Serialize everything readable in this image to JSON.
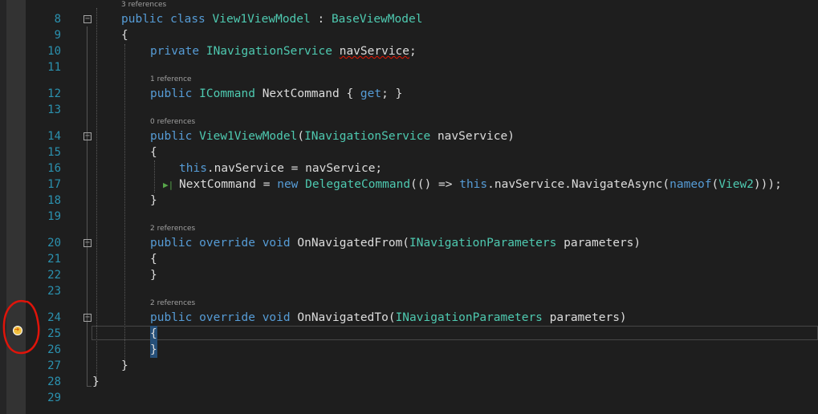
{
  "editor": {
    "codelens": {
      "line8": "3 references",
      "line12": "1 reference",
      "line14": "0 references",
      "line20": "2 references",
      "line24": "2 references"
    },
    "line_numbers": [
      "8",
      "9",
      "10",
      "11",
      "12",
      "13",
      "14",
      "15",
      "16",
      "17",
      "18",
      "19",
      "20",
      "21",
      "22",
      "23",
      "24",
      "25",
      "26",
      "27",
      "28",
      "29"
    ],
    "lines": {
      "l8": {
        "kw1": "public",
        "kw2": "class",
        "name": "View1ViewModel",
        "sep": " : ",
        "base": "BaseViewModel"
      },
      "l9": {
        "text": "{"
      },
      "l10": {
        "kw": "private",
        "type": "INavigationService",
        "field": "navService",
        "semi": ";"
      },
      "l12": {
        "kw": "public",
        "type": "ICommand",
        "rest": "NextCommand { ",
        "get": "get",
        "end": "; }"
      },
      "l14": {
        "kw": "public",
        "ctor": "View1ViewModel",
        "open": "(",
        "type": "INavigationService",
        "param": " navService)"
      },
      "l15": {
        "text": "{"
      },
      "l16": {
        "kw": "this",
        "rest": ".navService = navService;"
      },
      "l17": {
        "a": "NextCommand = ",
        "kw_new": "new",
        "type": "DelegateCommand",
        "b": "(() => ",
        "kw_this": "this",
        "c": ".navService.NavigateAsync(",
        "kw_nameof": "nameof",
        "d": "(",
        "type2": "View2",
        "e": ")));"
      },
      "l18": {
        "text": "}"
      },
      "l20": {
        "kw1": "public",
        "kw2": "override",
        "kw3": "void",
        "method": "OnNavigatedFrom(",
        "type": "INavigationParameters",
        "param": " parameters)"
      },
      "l21": {
        "text": "{"
      },
      "l22": {
        "text": "}"
      },
      "l24": {
        "kw1": "public",
        "kw2": "override",
        "kw3": "void",
        "method": "OnNavigatedTo(",
        "type": "INavigationParameters",
        "param": " parameters)"
      },
      "l25": {
        "text": "{"
      },
      "l26": {
        "text": "}"
      },
      "l27": {
        "text": "}"
      },
      "l28": {
        "text": "}"
      }
    },
    "colors": {
      "keyword": "#569cd6",
      "type": "#4ec9b0",
      "line_number": "#2b91af",
      "annotation_circle": "#e0140a",
      "breakpoint": "#f0c040"
    },
    "icons": {
      "breakpoint": "breakpoint-arrow-icon",
      "fold": "collapse-box-icon",
      "marker": "change-marker-icon"
    }
  }
}
